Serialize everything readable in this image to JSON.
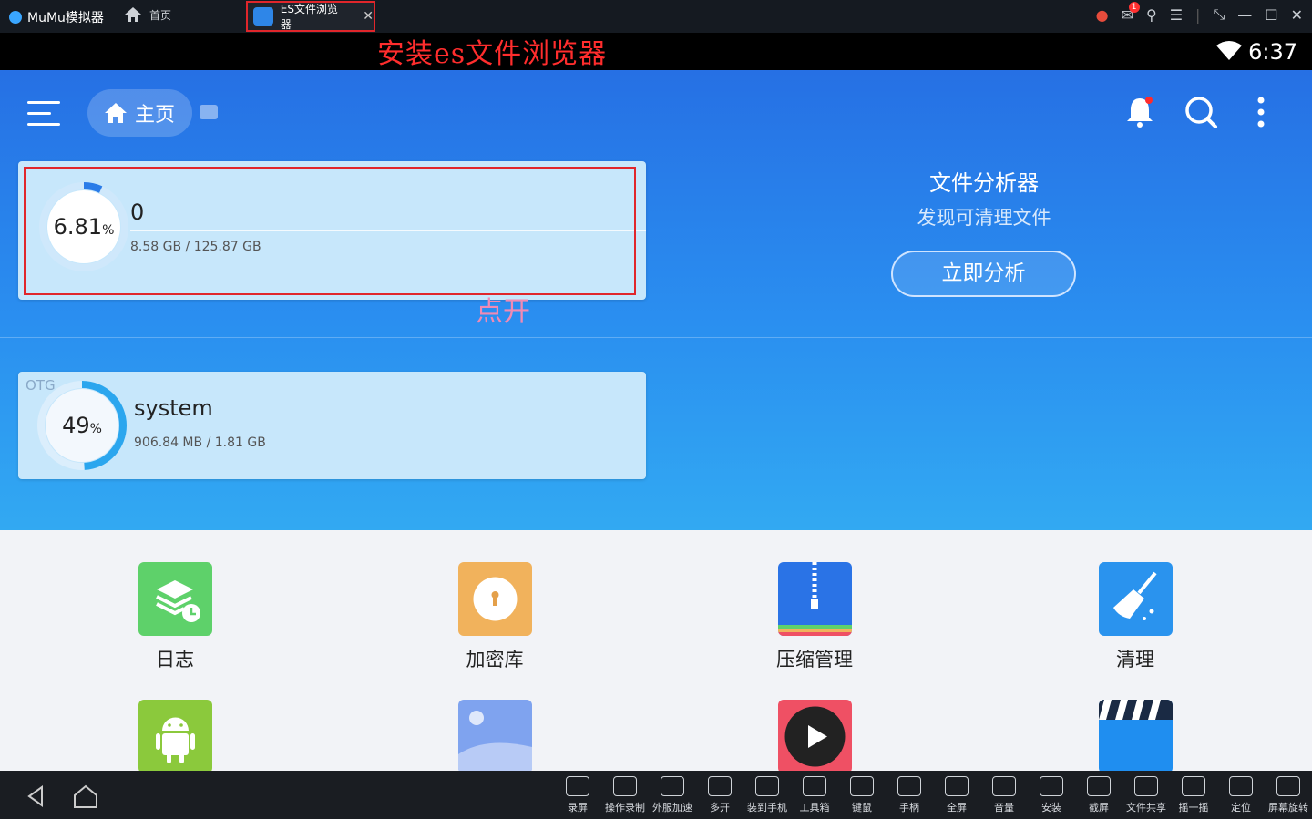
{
  "emulator": {
    "brand": "MuMu模拟器",
    "home_tab": "首页",
    "active_tab": "ES文件浏览器",
    "notification_count": "1"
  },
  "annotations": {
    "install": "安装es文件浏览器",
    "open": "点开"
  },
  "status": {
    "time": "6:37"
  },
  "header": {
    "home_label": "主页"
  },
  "storage": [
    {
      "percent": "6.81",
      "percent_unit": "%",
      "usage": 0.0681,
      "name": "0",
      "size": "8.58 GB / 125.87 GB"
    },
    {
      "tag": "OTG",
      "percent": "49",
      "percent_unit": "%",
      "usage": 0.49,
      "name": "system",
      "size": "906.84 MB / 1.81 GB"
    }
  ],
  "analyzer": {
    "title": "文件分析器",
    "subtitle": "发现可清理文件",
    "button": "立即分析"
  },
  "tools": [
    {
      "label": "日志",
      "icon": "log-icon",
      "color": "#5ed16a"
    },
    {
      "label": "加密库",
      "icon": "lock-icon",
      "color": "#f1b25c"
    },
    {
      "label": "压缩管理",
      "icon": "zip-icon",
      "color": "#2a73e6"
    },
    {
      "label": "清理",
      "icon": "broom-icon",
      "color": "#2a93ee"
    },
    {
      "label": "",
      "icon": "android-icon",
      "color": "#8bc93c"
    },
    {
      "label": "",
      "icon": "image-icon",
      "color": "#7fa3ef"
    },
    {
      "label": "",
      "icon": "play-icon",
      "color": "#ef5064"
    },
    {
      "label": "",
      "icon": "clapper-icon",
      "color": "#1f8ef0"
    }
  ],
  "bottom_bar": [
    "录屏",
    "操作录制",
    "外服加速",
    "多开",
    "装到手机",
    "工具箱",
    "键鼠",
    "手柄",
    "全屏",
    "音量",
    "安装",
    "截屏",
    "文件共享",
    "摇一摇",
    "定位",
    "屏幕旋转"
  ]
}
